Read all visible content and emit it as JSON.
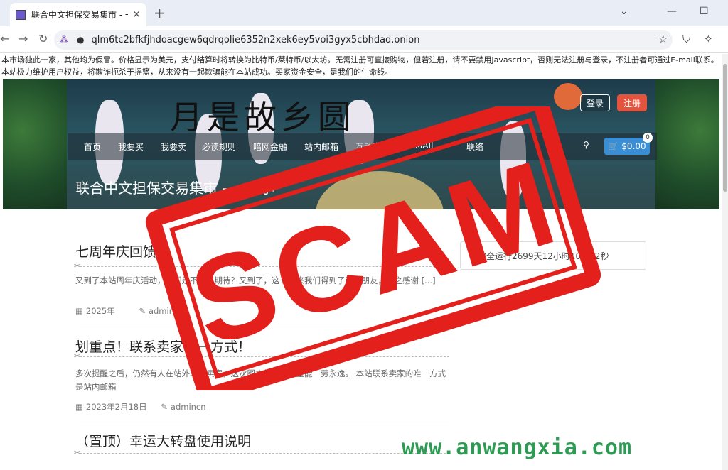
{
  "browser": {
    "tab_title": "联合中文担保交易集市 - 一个小",
    "url": "qlm6tc2bfkfjhdoacgew6qdrqolie6352n2xek6ey5voi3gyx5cbhdad.onion"
  },
  "notice": "本市场独此一家，其他均为假冒。价格显示为美元，支付结算时将转换为比特币/莱特币/以太坊。无需注册可直接购物，但若注册，请不要禁用Javascript，否则无法注册与登录，不注册者可通过E-mail联系。本站极力维护用户权益，将欺诈扼杀于摇篮，从来没有一起欺骗能在本站成功。买家资金安全，是我们的生命线。",
  "banner": {
    "calligraphy": "月是故乡圆",
    "login": "登录",
    "register": "注册",
    "menu": [
      "首页",
      "我要买",
      "我要卖",
      "必读规则",
      "暗网金融",
      "站内邮箱",
      "互动空间",
      "E-MAIL",
      "联络"
    ],
    "cart": "$0.00",
    "cart_count": "0",
    "site_title": "联合中文担保交易集市 - 一个小"
  },
  "sidebar": {
    "runtime": "已安全运行2699天12小时10分12秒"
  },
  "posts": [
    {
      "title": "七周年庆回馈",
      "excerpt": "又到了本站周年庆活动，我们是不是很期待？又到了，这七年来我们得到了许多朋友，总之感谢 [...]",
      "date": "2025年",
      "author": "admincn"
    },
    {
      "title": "划重点！联系卖家唯一方式！",
      "excerpt": "多次提醒之后，仍然有人在站外联系卖家，这次图文并茂，希望能一劳永逸。 本站联系卖家的唯一方式是站内邮箱",
      "date": "2023年2月18日",
      "author": "admincn"
    },
    {
      "title": "（置顶）幸运大转盘使用说明",
      "excerpt": "",
      "date": "",
      "author": ""
    }
  ],
  "overlay": {
    "stamp": "SCAM",
    "watermark": "www.anwangxia.com"
  },
  "colors": {
    "stamp_red": "#e3201b",
    "register_red": "#e4533e",
    "cart_blue": "#3a8ed6",
    "watermark_green": "#2e9b54"
  }
}
